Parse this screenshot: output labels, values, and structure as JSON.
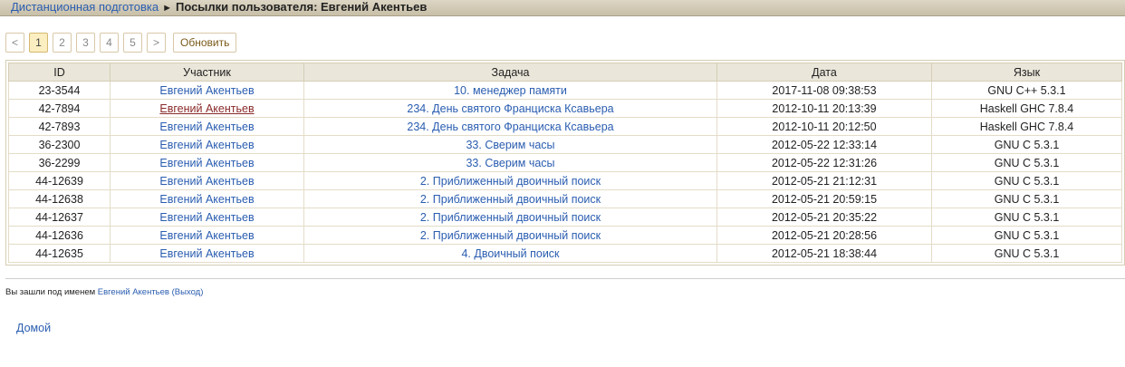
{
  "breadcrumb": {
    "home": "Дистанционная подготовка",
    "separator": "►",
    "current": "Посылки пользователя: Евгений Акентьев"
  },
  "pager": {
    "prev": "<",
    "pages": [
      "1",
      "2",
      "3",
      "4",
      "5"
    ],
    "active_page": "1",
    "next": ">",
    "refresh": "Обновить"
  },
  "table": {
    "headers": [
      "ID",
      "Участник",
      "Задача",
      "Дата",
      "Язык"
    ],
    "rows": [
      {
        "id": "23-3544",
        "user": "Евгений Акентьев",
        "task": "10. менеджер памяти",
        "date": "2017-11-08 09:38:53",
        "lang": "GNU C++ 5.3.1"
      },
      {
        "id": "42-7894",
        "user": "Евгений Акентьев",
        "task": "234. День святого Франциска Ксавьера",
        "date": "2012-10-11 20:13:39",
        "lang": "Haskell GHC 7.8.4"
      },
      {
        "id": "42-7893",
        "user": "Евгений Акентьев",
        "task": "234. День святого Франциска Ксавьера",
        "date": "2012-10-11 20:12:50",
        "lang": "Haskell GHC 7.8.4"
      },
      {
        "id": "36-2300",
        "user": "Евгений Акентьев",
        "task": "33. Сверим часы",
        "date": "2012-05-22 12:33:14",
        "lang": "GNU C 5.3.1"
      },
      {
        "id": "36-2299",
        "user": "Евгений Акентьев",
        "task": "33. Сверим часы",
        "date": "2012-05-22 12:31:26",
        "lang": "GNU C 5.3.1"
      },
      {
        "id": "44-12639",
        "user": "Евгений Акентьев",
        "task": "2. Приближенный двоичный поиск",
        "date": "2012-05-21 21:12:31",
        "lang": "GNU C 5.3.1"
      },
      {
        "id": "44-12638",
        "user": "Евгений Акентьев",
        "task": "2. Приближенный двоичный поиск",
        "date": "2012-05-21 20:59:15",
        "lang": "GNU C 5.3.1"
      },
      {
        "id": "44-12637",
        "user": "Евгений Акентьев",
        "task": "2. Приближенный двоичный поиск",
        "date": "2012-05-21 20:35:22",
        "lang": "GNU C 5.3.1"
      },
      {
        "id": "44-12636",
        "user": "Евгений Акентьев",
        "task": "2. Приближенный двоичный поиск",
        "date": "2012-05-21 20:28:56",
        "lang": "GNU C 5.3.1"
      },
      {
        "id": "44-12635",
        "user": "Евгений Акентьев",
        "task": "4. Двоичный поиск",
        "date": "2012-05-21 18:38:44",
        "lang": "GNU C 5.3.1"
      }
    ]
  },
  "footer": {
    "login_prefix": "Вы зашли под именем",
    "login_user": "Евгений Акентьев",
    "logout": "(Выход)",
    "home": "Домой"
  },
  "colors": {
    "link": "#2a5db0",
    "link_hover": "#8b2a2a",
    "active_page_bg": "#fbeec0"
  }
}
